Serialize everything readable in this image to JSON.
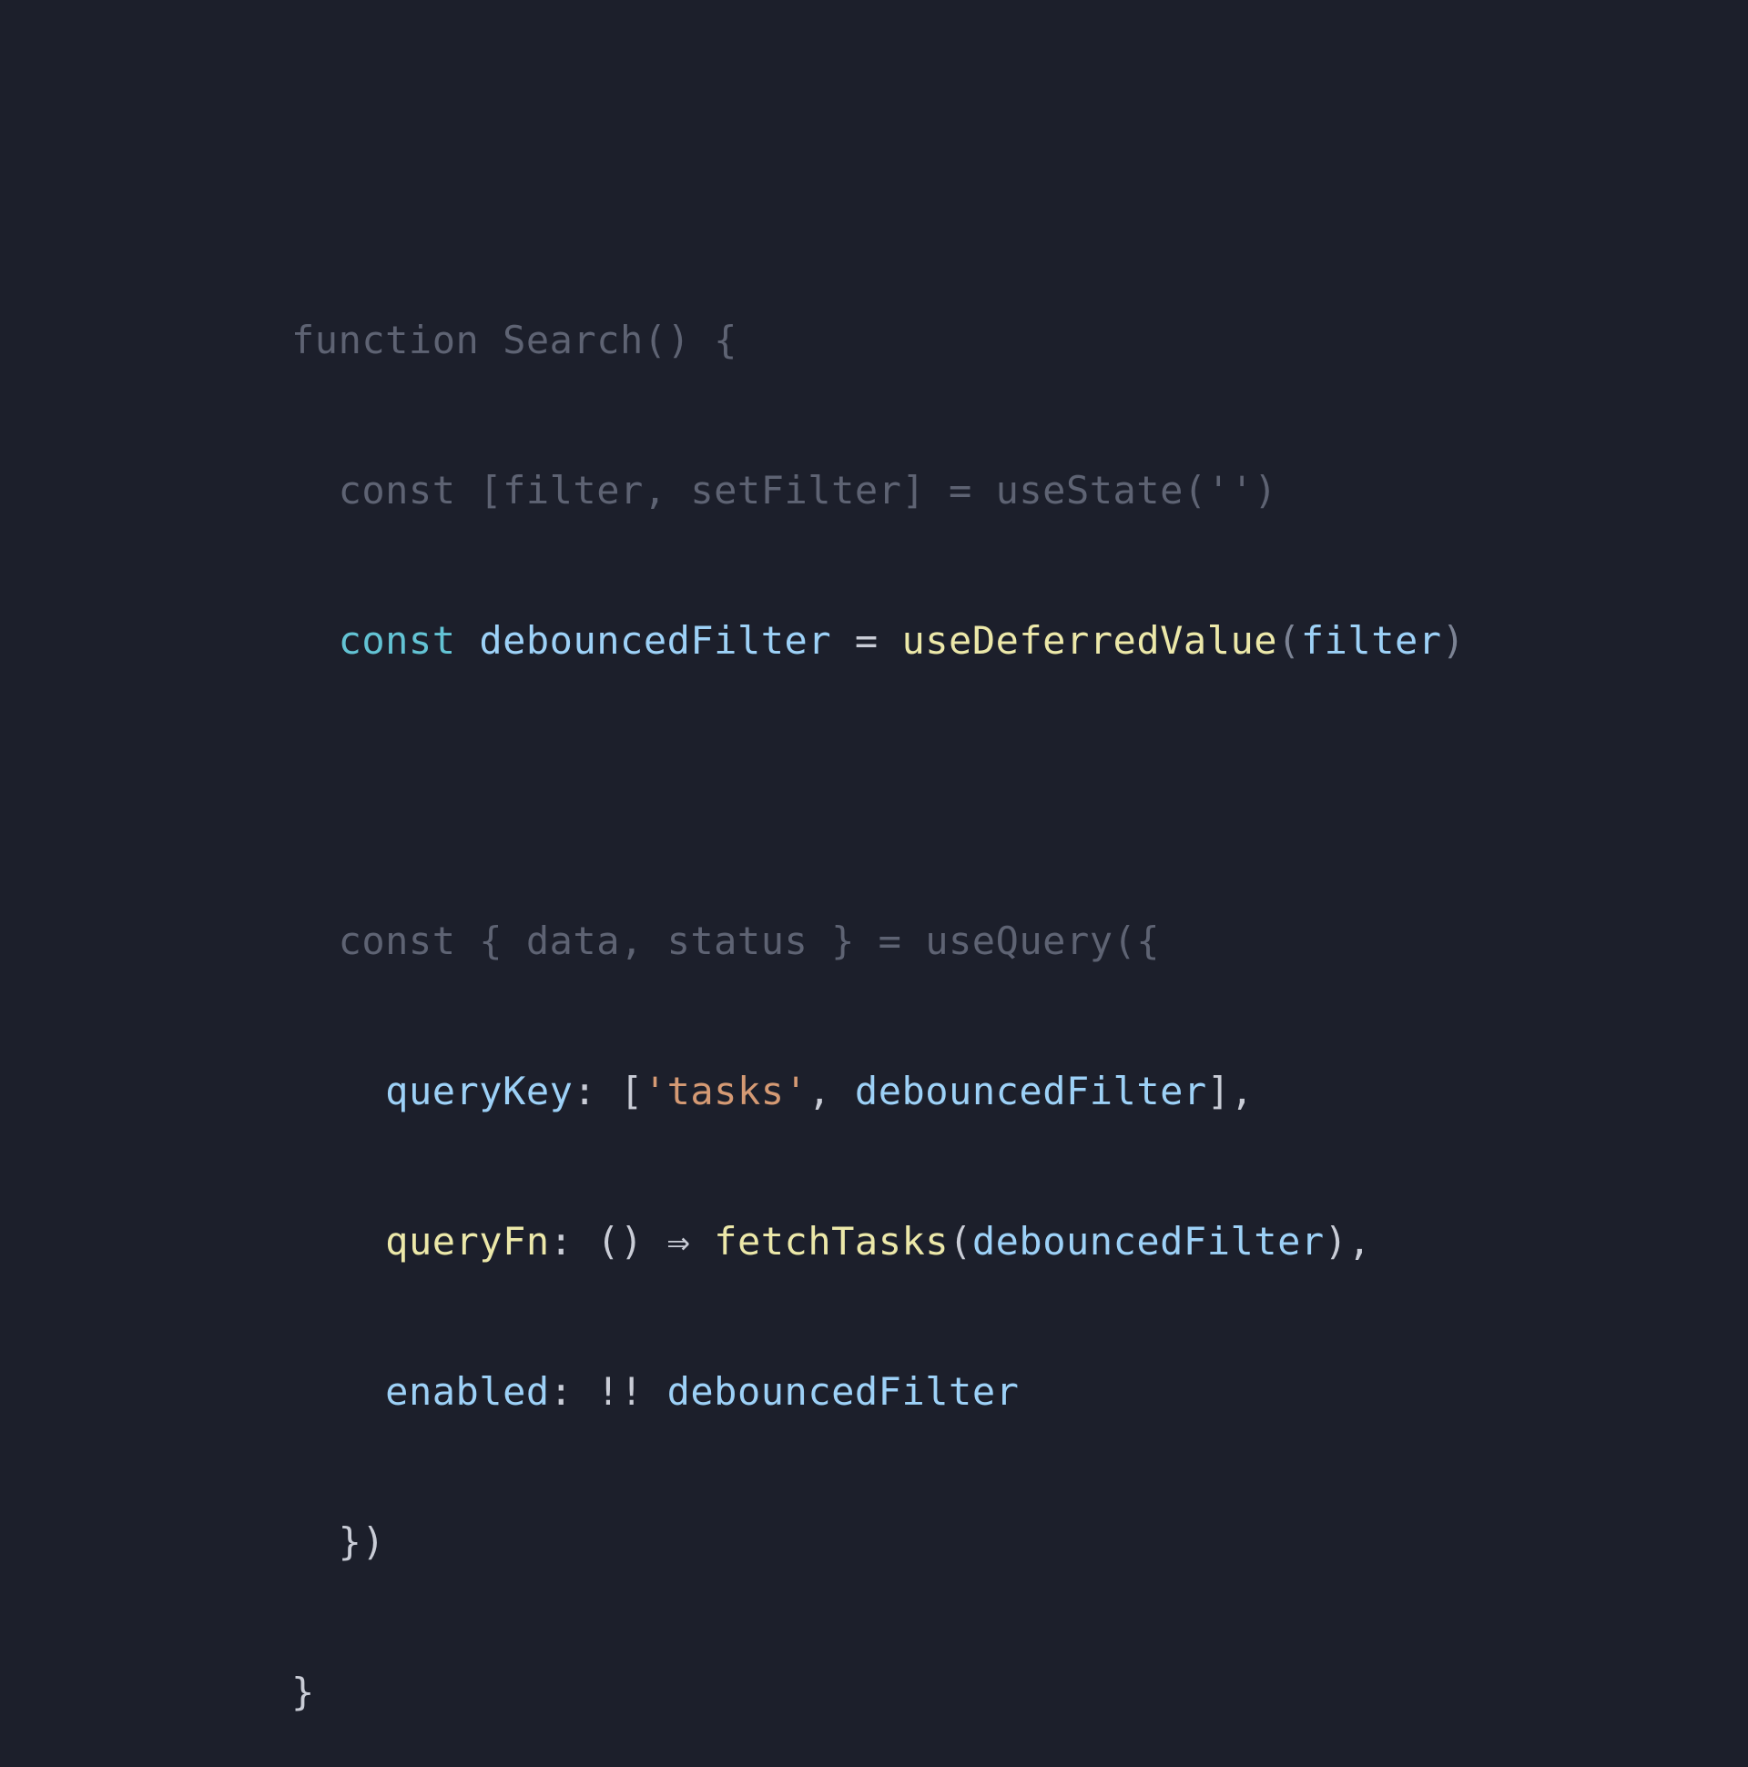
{
  "code": {
    "line1": {
      "text": "function Search() {"
    },
    "line2": {
      "text": "  const [filter, setFilter] = useState('')"
    },
    "line3": {
      "indent": "  ",
      "kw": "const",
      "sp1": " ",
      "var": "debouncedFilter",
      "op": " = ",
      "fn": "useDeferredValue",
      "open": "(",
      "arg": "filter",
      "close": ")"
    },
    "line4": {
      "text": ""
    },
    "line5": {
      "text": "  const { data, status } = useQuery({"
    },
    "line6": {
      "indent": "    ",
      "key": "queryKey",
      "colon": ": [",
      "str": "'tasks'",
      "comma": ", ",
      "var": "debouncedFilter",
      "end": "],"
    },
    "line7": {
      "indent": "    ",
      "key": "queryFn",
      "colon": ": () ⇒ ",
      "fn": "fetchTasks",
      "open": "(",
      "var": "debouncedFilter",
      "end": "),"
    },
    "line8": {
      "indent": "    ",
      "key": "enabled",
      "colon": ": !! ",
      "var": "debouncedFilter"
    },
    "line9": {
      "text": "  })"
    },
    "line10": {
      "text": "}"
    }
  }
}
